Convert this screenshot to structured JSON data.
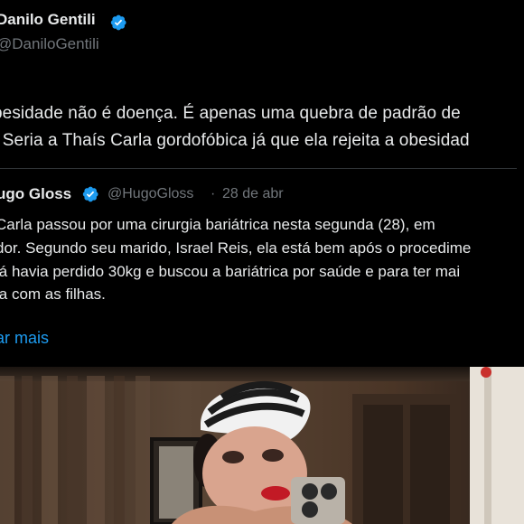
{
  "tweet": {
    "author_name": "Danilo Gentili",
    "author_handle": "@DaniloGentili",
    "text_lines": [
      "besidade não é doença. É apenas uma quebra de padrão de",
      ". Seria a Thaís Carla gordofóbica já que ela rejeita a obesidad"
    ]
  },
  "quoted": {
    "author_name": "ugo Gloss",
    "author_handle": "@HugoGloss",
    "separator": "·",
    "date": "28 de abr",
    "text_lines": [
      "Carla passou por uma cirurgia bariátrica nesta segunda (28), em",
      "dor. Segundo seu marido, Israel Reis, ela está bem após o procedime",
      "já havia perdido 30kg e buscou a bariátrica por saúde e para ter mai",
      "ia com as filhas."
    ],
    "show_more": "ar mais"
  },
  "icons": {
    "verified": "verified-badge-icon"
  },
  "colors": {
    "background": "#000000",
    "text": "#e7e9ea",
    "secondary": "#71767b",
    "accent": "#1d9bf0"
  }
}
